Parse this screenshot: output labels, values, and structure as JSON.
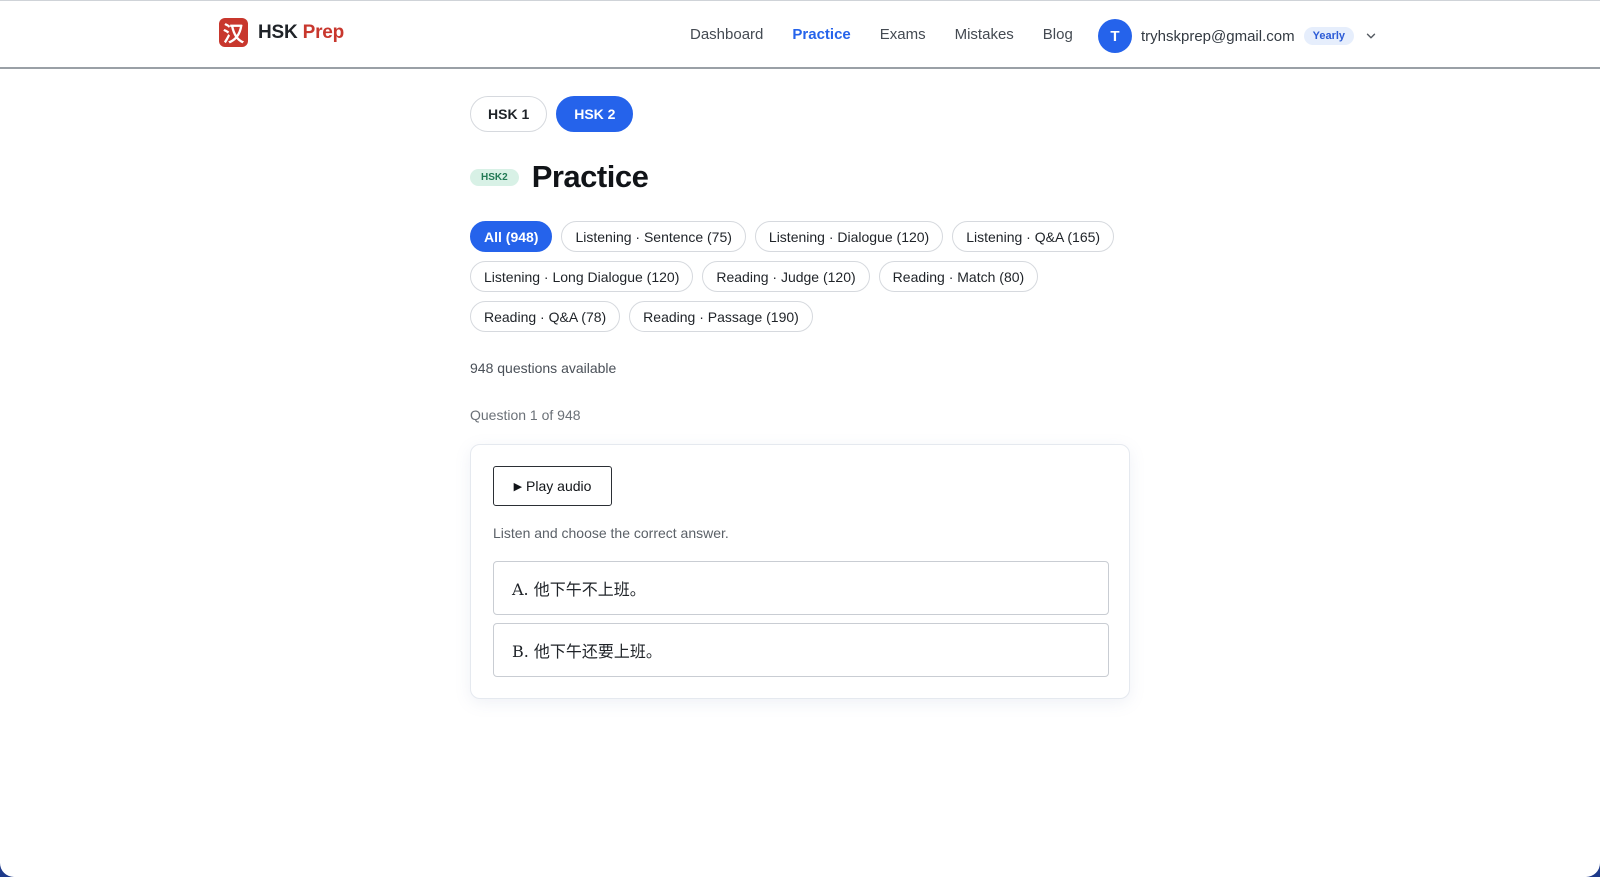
{
  "header": {
    "logo_glyph": "汉",
    "brand_part1": "HSK",
    "brand_part2": "Prep",
    "brand_color": "#c8372d",
    "nav": [
      {
        "label": "Dashboard",
        "active": false
      },
      {
        "label": "Practice",
        "active": true
      },
      {
        "label": "Exams",
        "active": false
      },
      {
        "label": "Mistakes",
        "active": false
      },
      {
        "label": "Blog",
        "active": false
      }
    ],
    "user": {
      "avatar_letter": "T",
      "email": "tryhskprep@gmail.com",
      "plan": "Yearly",
      "menu_icon": "chevron-down-icon"
    }
  },
  "levels": [
    {
      "label": "HSK 1",
      "active": false
    },
    {
      "label": "HSK 2",
      "active": true
    }
  ],
  "page": {
    "badge": "HSK2",
    "title": "Practice"
  },
  "filters": [
    {
      "label": "All (948)",
      "active": true
    },
    {
      "label": "Listening · Sentence (75)",
      "active": false
    },
    {
      "label": "Listening · Dialogue (120)",
      "active": false
    },
    {
      "label": "Listening · Q&A (165)",
      "active": false
    },
    {
      "label": "Listening · Long Dialogue (120)",
      "active": false
    },
    {
      "label": "Reading · Judge (120)",
      "active": false
    },
    {
      "label": "Reading · Match (80)",
      "active": false
    },
    {
      "label": "Reading · Q&A (78)",
      "active": false
    },
    {
      "label": "Reading · Passage (190)",
      "active": false
    }
  ],
  "summary": {
    "available": "948 questions available",
    "progress": "Question 1 of 948"
  },
  "question": {
    "play_icon": "play-icon",
    "play_label": "Play audio",
    "instruction": "Listen and choose the correct answer.",
    "options": [
      {
        "text": "A. 他下午不上班。"
      },
      {
        "text": "B. 他下午还要上班。"
      }
    ]
  },
  "colors": {
    "accent": "#2563eb",
    "badge_bg": "#d8f1e6",
    "badge_text": "#237a56"
  }
}
